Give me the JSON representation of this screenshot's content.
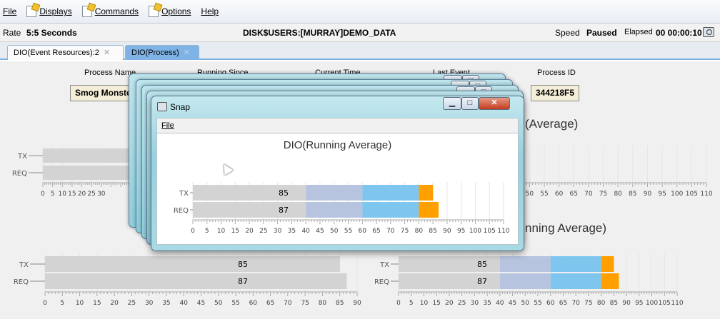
{
  "menu": {
    "file": "File",
    "displays": "Displays",
    "commands": "Commands",
    "options": "Options",
    "help": "Help"
  },
  "infobar": {
    "rate_label": "Rate",
    "rate_value": "5:5 Seconds",
    "path": "DISK$USERS:[MURRAY]DEMO_DATA",
    "speed_label": "Speed",
    "state": "Paused",
    "elapsed_label": "Elapsed",
    "elapsed_value": "00 00:00:10"
  },
  "tabs": [
    {
      "label": "DIO(Event Resources):2",
      "active": true
    },
    {
      "label": "DIO(Process)",
      "active": false
    }
  ],
  "process": {
    "headers": {
      "process_name": "Process Name",
      "running_since": "Running Since",
      "current_time": "Current Time",
      "last_event": "Last Event",
      "process_id": "Process ID"
    },
    "process_name_value": "Smog Monste",
    "process_id_value": "344218F5"
  },
  "background_titles": {
    "right_top_fragment": "(Average)",
    "right_bottom_fragment": "nning Average)"
  },
  "snap_window": {
    "title": "Snap",
    "menu_file": "File",
    "chart_title": "DIO(Running Average)"
  },
  "colors": {
    "segment_gray": "#d3d3d3",
    "segment_slate": "#b7c4df",
    "segment_blue": "#7fc6ef",
    "segment_orange": "#ffa000",
    "tab_inactive": "#7fb3e6",
    "value_box": "#f4eed8"
  },
  "chart_data": [
    {
      "id": "snap-chart",
      "type": "bar",
      "orientation": "horizontal",
      "stacked": true,
      "title": "DIO(Running Average)",
      "categories": [
        "TX",
        "REQ"
      ],
      "series": [
        {
          "values": [
            40,
            40
          ],
          "color": "#d3d3d3"
        },
        {
          "values": [
            20,
            20
          ],
          "color": "#b7c4df"
        },
        {
          "values": [
            20,
            20
          ],
          "color": "#7fc6ef"
        },
        {
          "values": [
            5,
            7
          ],
          "color": "#ffa000"
        }
      ],
      "labels": [
        "85",
        "87"
      ],
      "xlim": [
        0,
        110
      ],
      "xticks": [
        0,
        5,
        10,
        15,
        20,
        25,
        30,
        35,
        40,
        45,
        50,
        55,
        60,
        65,
        70,
        75,
        80,
        85,
        90,
        95,
        100,
        105,
        110
      ]
    },
    {
      "id": "top-left-chart",
      "type": "bar",
      "orientation": "horizontal",
      "stacked": true,
      "categories": [
        "TX",
        "REQ"
      ],
      "series": [
        {
          "values": [
            85,
            87
          ],
          "color": "#d3d3d3"
        }
      ],
      "labels": [
        "85",
        "87"
      ],
      "xlim": [
        0,
        110
      ],
      "xticks": [
        0,
        5,
        10,
        15,
        20,
        25,
        30
      ]
    },
    {
      "id": "top-right-chart",
      "type": "bar",
      "orientation": "horizontal",
      "categories": [
        "TX",
        "REQ"
      ],
      "series": [],
      "labels": [
        "",
        ""
      ],
      "xlim": [
        0,
        110
      ],
      "xticks": [
        45,
        50,
        55,
        60,
        65,
        70,
        75,
        80,
        85,
        90,
        95,
        100,
        105,
        110
      ]
    },
    {
      "id": "bottom-left-chart",
      "type": "bar",
      "orientation": "horizontal",
      "stacked": true,
      "categories": [
        "TX",
        "REQ"
      ],
      "series": [
        {
          "values": [
            85,
            87
          ],
          "color": "#d3d3d3"
        }
      ],
      "labels": [
        "85",
        "87"
      ],
      "xlim": [
        0,
        90
      ],
      "xticks": [
        0,
        5,
        10,
        15,
        20,
        25,
        30,
        35,
        40,
        45,
        50,
        55,
        60,
        65,
        70,
        75,
        80,
        85,
        90
      ]
    },
    {
      "id": "bottom-right-chart",
      "type": "bar",
      "orientation": "horizontal",
      "stacked": true,
      "categories": [
        "TX",
        "REQ"
      ],
      "series": [
        {
          "values": [
            40,
            40
          ],
          "color": "#d3d3d3"
        },
        {
          "values": [
            20,
            20
          ],
          "color": "#b7c4df"
        },
        {
          "values": [
            20,
            20
          ],
          "color": "#7fc6ef"
        },
        {
          "values": [
            5,
            7
          ],
          "color": "#ffa000"
        }
      ],
      "labels": [
        "85",
        "87"
      ],
      "xlim": [
        0,
        110
      ],
      "xticks": [
        0,
        5,
        10,
        15,
        20,
        25,
        30,
        35,
        40,
        45,
        50,
        55,
        60,
        65,
        70,
        75,
        80,
        85,
        90,
        95,
        100,
        105,
        110
      ]
    }
  ]
}
